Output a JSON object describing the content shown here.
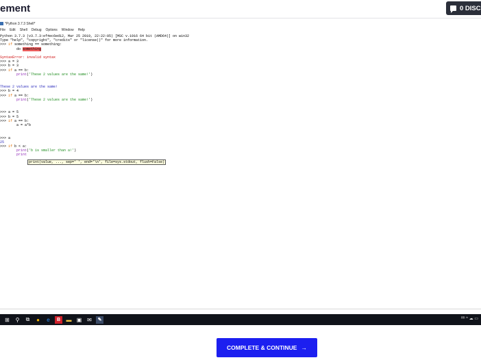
{
  "header": {
    "title": "ement",
    "discussion_label": "0 DISCU"
  },
  "shell": {
    "title": "*Python 3.7.3 Shell*",
    "menu": [
      "File",
      "Edit",
      "Shell",
      "Debug",
      "Options",
      "Window",
      "Help"
    ],
    "lines": [
      "Python 3.7.3 (v3.7.3:ef4ec6ed12, Mar 25 2019, 22:22:05) [MSC v.1916 64 bit (AMD64)] on win32",
      "Type \"help\", \"copyright\", \"credits\" or \"license()\" for more information.",
      ">>> if something == something:",
      "        do something",
      "",
      "SyntaxError: invalid syntax",
      ">>> a = 3",
      ">>> b = 3",
      ">>> if a == b:",
      "        print('These 2 values are the same!')",
      "",
      "",
      "These 2 values are the same!",
      ">>> b = 4",
      ">>> if a == b:",
      "        print('These 2 values are the same!')",
      "",
      "",
      ">>> a = 5",
      ">>> b = 5",
      ">>> if a == b:",
      "        a = a*b",
      "",
      "",
      ">>> a",
      "25",
      ">>> if b < a:",
      "        print('b is smaller than a!')",
      "        print"
    ],
    "calltip": "print(value, ..., sep=' ', end='\\n', file=sys.stdout, flush=False)"
  },
  "taskbar": {
    "icons": [
      "windows-start-icon",
      "search-icon",
      "task-view-icon",
      "chrome-icon",
      "edge-icon",
      "app-b-icon",
      "file-explorer-icon",
      "store-icon",
      "mail-icon",
      "python-idle-icon"
    ],
    "tray": "ᴿᴿ ^ ☁ ▭"
  },
  "footer": {
    "continue_label": "COMPLETE & CONTINUE",
    "continue_arrow": "→"
  },
  "colors": {
    "continue_button": "#1c1ff0",
    "taskbar": "#10131a",
    "keyword": "#e37000",
    "string": "#1a8a1a",
    "builtin": "#8a1fb4",
    "error": "#cc0000",
    "output": "#1f1fb8"
  }
}
